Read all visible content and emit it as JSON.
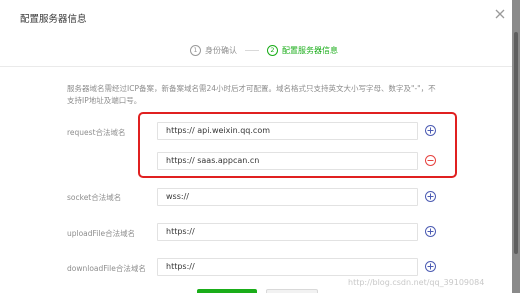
{
  "dialog": {
    "title": "配置服务器信息",
    "close_icon": "close-icon"
  },
  "steps": [
    {
      "number": "1",
      "label": "身份确认",
      "active": false
    },
    {
      "number": "2",
      "label": "配置服务器信息",
      "active": true
    }
  ],
  "notice": "服务器域名需经过ICP备案，新备案域名需24小时后才可配置。域名格式只支持英文大小写字母、数字及\"-\"，不支持IP地址及端口号。",
  "fields": {
    "request": {
      "label": "request合法域名",
      "values": [
        "https:// api.weixin.qq.com",
        "https:// saas.appcan.cn"
      ]
    },
    "socket": {
      "label": "socket合法域名",
      "value": "wss://"
    },
    "uploadFile": {
      "label": "uploadFile合法域名",
      "value": "https://"
    },
    "downloadFile": {
      "label": "downloadFile合法域名",
      "value": "https://"
    }
  },
  "icons": {
    "add": "plus-circle-icon",
    "remove": "minus-circle-icon"
  },
  "colors": {
    "accent_green": "#1aad19",
    "add_blue": "#4d5cb3",
    "remove_red": "#e64340",
    "highlight_red": "#e02020"
  },
  "watermark": "http://blog.csdn.net/qq_39109084"
}
